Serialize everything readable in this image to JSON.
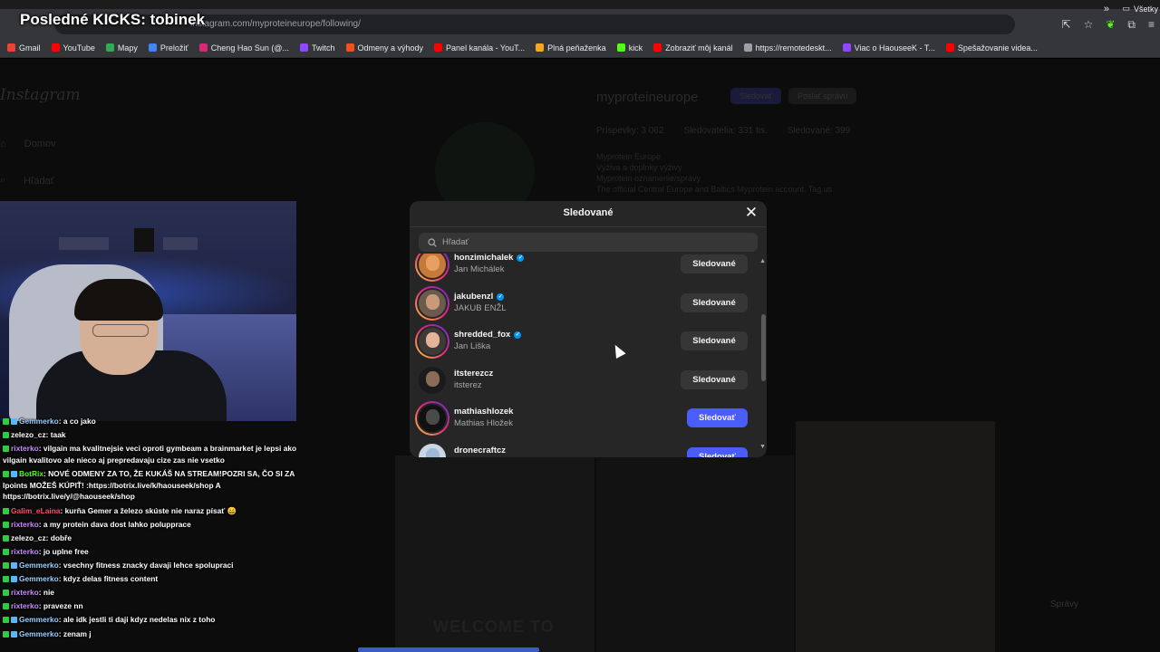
{
  "overlay_title": "Posledné KICKS: tobinek",
  "browser": {
    "url": "instagram.com/myproteineurope/following/",
    "bookmarks": [
      {
        "label": "Gmail",
        "color": "#ea4335"
      },
      {
        "label": "YouTube",
        "color": "#ff0000"
      },
      {
        "label": "Mapy",
        "color": "#34a853"
      },
      {
        "label": "Preložiť",
        "color": "#4285f4"
      },
      {
        "label": "Cheng Hao Sun (@...",
        "color": "#d62976"
      },
      {
        "label": "Twitch",
        "color": "#9146ff"
      },
      {
        "label": "Odmeny a výhody",
        "color": "#f25022"
      },
      {
        "label": "Panel kanála - YouT...",
        "color": "#ff0000"
      },
      {
        "label": "Plná peňaženka",
        "color": "#f5a623"
      },
      {
        "label": "kick",
        "color": "#53fc18"
      },
      {
        "label": "Zobraziť môj kanál",
        "color": "#ff0000"
      },
      {
        "label": "https://remotedeskt...",
        "color": "#9aa0a6"
      },
      {
        "label": "Viac o HaouseeK - T...",
        "color": "#9146ff"
      },
      {
        "label": "Spešažovanie videa...",
        "color": "#ff0000"
      }
    ],
    "bookmarks_all": "Všetky"
  },
  "background": {
    "logo": "Instagram",
    "nav": [
      "Domov",
      "Hľadať"
    ],
    "profile_name": "myproteineurope",
    "follow_btn": "Sledovať",
    "message_btn": "Poslať správu",
    "stats": [
      "Príspevky: 3 062",
      "Sledovatelia: 331 tis.",
      "Sledované: 399"
    ],
    "bio": [
      "Myprotein Europe",
      "Výživa a doplnky výživy",
      "Myprotein oznámenie/správy",
      "The official Central Europe and Baltics Myprotein account. Tag us"
    ],
    "welcome": "WELCOME TO",
    "messages": "Správy"
  },
  "chat": [
    {
      "user": "Gemmerko",
      "color": "#9ad1ff",
      "text": ": a co jako",
      "badges": 2
    },
    {
      "user": "zelezo_cz",
      "color": "#ffffff",
      "text": ": taak",
      "badges": 1
    },
    {
      "user": "rixterko",
      "color": "#c88cff",
      "text": ": vilgain ma kvalitnejsie veci oproti gymbeam a brainmarket je lepsi ako vilgain kvalitovo ale nieco aj prepredavaju cize zas nie vsetko",
      "badges": 1,
      "wrap": true
    },
    {
      "user": "BotRix",
      "color": "#53fc18",
      "text": ": NOVÉ ODMENY ZA TO, ŽE KUKÁŠ NA STREAM!POZRI SA, ČO SI ZA Ipoints MOŽEŠ KÚPIŤ! :https://botrix.live/k/haouseek/shop A https://botrix.live/y/@haouseek/shop",
      "badges": 2,
      "wrap": true
    },
    {
      "user": "Galim_eLaina",
      "color": "#ff4d6d",
      "text": ": kurňa Gemer a železo skúste nie naraz písať 😄",
      "badges": 1
    },
    {
      "user": "rixterko",
      "color": "#c88cff",
      "text": ": a my protein dava dost lahko polupprace",
      "badges": 1
    },
    {
      "user": "zelezo_cz",
      "color": "#ffffff",
      "text": ": dobře",
      "badges": 1
    },
    {
      "user": "rixterko",
      "color": "#c88cff",
      "text": ": jo uplne free",
      "badges": 1
    },
    {
      "user": "Gemmerko",
      "color": "#9ad1ff",
      "text": ": vsechny fitness znacky davaji lehce spolupraci",
      "badges": 2
    },
    {
      "user": "Gemmerko",
      "color": "#9ad1ff",
      "text": ": kdyz delas fitness content",
      "badges": 2
    },
    {
      "user": "rixterko",
      "color": "#c88cff",
      "text": ": nie",
      "badges": 1
    },
    {
      "user": "rixterko",
      "color": "#c88cff",
      "text": ": praveze nn",
      "badges": 1
    },
    {
      "user": "Gemmerko",
      "color": "#9ad1ff",
      "text": ": ale idk jestli ti daji kdyz nedelas nix z toho",
      "badges": 2
    },
    {
      "user": "Gemmerko",
      "color": "#9ad1ff",
      "text": ": zenam j",
      "badges": 2
    }
  ],
  "modal": {
    "title": "Sledované",
    "search_placeholder": "Hľadať",
    "accounts": [
      {
        "username": "honzimichalek",
        "fullname": "Jan Michálek",
        "verified": true,
        "button": "Sledované",
        "state": "following",
        "face": "#e8a062",
        "bg": "#c7793a",
        "ring": true
      },
      {
        "username": "jakubenzl",
        "fullname": "JAKUB ENŽL",
        "verified": true,
        "button": "Sledované",
        "state": "following",
        "face": "#c99a7a",
        "bg": "#6b5a4e",
        "ring": true
      },
      {
        "username": "shredded_fox",
        "fullname": "Jan Liška",
        "verified": true,
        "button": "Sledované",
        "state": "following",
        "face": "#e4b49a",
        "bg": "#3d3a38",
        "ring": true
      },
      {
        "username": "itsterezcz",
        "fullname": "itsterez",
        "verified": false,
        "button": "Sledované",
        "state": "following",
        "face": "#8a6a58",
        "bg": "#1b1b1b",
        "ring": false
      },
      {
        "username": "mathiashlozek",
        "fullname": "Mathias Hložek",
        "verified": false,
        "button": "Sledovať",
        "state": "follow",
        "face": "#4a4a4a",
        "bg": "#111111",
        "ring": true
      },
      {
        "username": "dronecraftcz",
        "fullname": "",
        "verified": false,
        "button": "Sledovať",
        "state": "follow",
        "face": "#9fb8d4",
        "bg": "#c9d6e6",
        "ring": false
      }
    ]
  }
}
